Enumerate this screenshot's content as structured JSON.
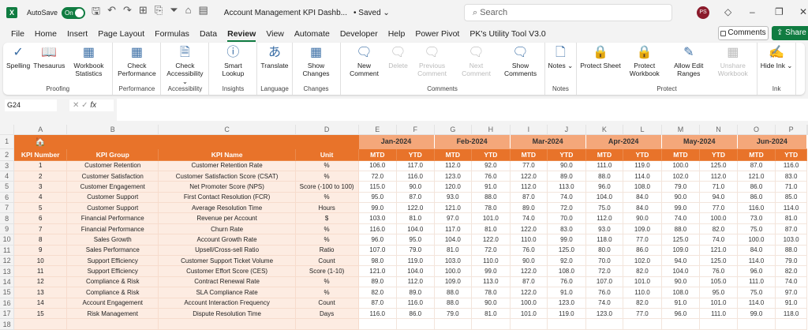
{
  "titlebar": {
    "app_icon": "X",
    "autosave_label": "AutoSave",
    "autosave_state": "On",
    "doc_title": "Account Management KPI Dashb...",
    "saved": "• Saved ⌄",
    "search_placeholder": "Search",
    "avatar": "PS"
  },
  "tabs": [
    "File",
    "Home",
    "Insert",
    "Page Layout",
    "Formulas",
    "Data",
    "Review",
    "View",
    "Automate",
    "Developer",
    "Help",
    "Power Pivot",
    "PK's Utility Tool V3.0"
  ],
  "active_tab": "Review",
  "comments_button": "Comments",
  "share_button": "Share",
  "ribbon": [
    {
      "group": "Proofing",
      "buttons": [
        {
          "label": "Spelling",
          "icon": "spelling-icon",
          "glyph": "✓"
        },
        {
          "label": "Thesaurus",
          "icon": "thesaurus-icon",
          "glyph": "📖"
        },
        {
          "label": "Workbook Statistics",
          "icon": "workbook-statistics-icon",
          "glyph": "▦"
        }
      ]
    },
    {
      "group": "Performance",
      "buttons": [
        {
          "label": "Check Performance",
          "icon": "check-performance-icon",
          "glyph": "▦"
        }
      ]
    },
    {
      "group": "Accessibility",
      "buttons": [
        {
          "label": "Check Accessibility ⌄",
          "icon": "check-accessibility-icon",
          "glyph": "🗎"
        }
      ]
    },
    {
      "group": "Insights",
      "buttons": [
        {
          "label": "Smart Lookup",
          "icon": "smart-lookup-icon",
          "glyph": "ⓘ"
        }
      ]
    },
    {
      "group": "Language",
      "buttons": [
        {
          "label": "Translate",
          "icon": "translate-icon",
          "glyph": "あ"
        }
      ]
    },
    {
      "group": "Changes",
      "buttons": [
        {
          "label": "Show Changes",
          "icon": "show-changes-icon",
          "glyph": "▦"
        }
      ]
    },
    {
      "group": "Comments",
      "buttons": [
        {
          "label": "New Comment",
          "icon": "new-comment-icon",
          "glyph": "🗨"
        },
        {
          "label": "Delete",
          "icon": "delete-comment-icon",
          "glyph": "🗨",
          "disabled": true
        },
        {
          "label": "Previous Comment",
          "icon": "previous-comment-icon",
          "glyph": "🗨",
          "disabled": true
        },
        {
          "label": "Next Comment",
          "icon": "next-comment-icon",
          "glyph": "🗨",
          "disabled": true
        },
        {
          "label": "Show Comments",
          "icon": "show-comments-icon",
          "glyph": "🗨"
        }
      ]
    },
    {
      "group": "Notes",
      "buttons": [
        {
          "label": "Notes ⌄",
          "icon": "notes-icon",
          "glyph": "🗋"
        }
      ]
    },
    {
      "group": "Protect",
      "buttons": [
        {
          "label": "Protect Sheet",
          "icon": "protect-sheet-icon",
          "glyph": "🔒"
        },
        {
          "label": "Protect Workbook",
          "icon": "protect-workbook-icon",
          "glyph": "🔒"
        },
        {
          "label": "Allow Edit Ranges",
          "icon": "allow-edit-ranges-icon",
          "glyph": "✎"
        },
        {
          "label": "Unshare Workbook",
          "icon": "unshare-workbook-icon",
          "glyph": "▦",
          "disabled": true
        }
      ]
    },
    {
      "group": "Ink",
      "buttons": [
        {
          "label": "Hide Ink ⌄",
          "icon": "hide-ink-icon",
          "glyph": "✍"
        }
      ]
    }
  ],
  "formula_bar": {
    "name_box": "G24",
    "fx": "fx",
    "value": ""
  },
  "sheet": {
    "columns": [
      "A",
      "B",
      "C",
      "D",
      "E",
      "F",
      "G",
      "H",
      "I",
      "J",
      "K",
      "L",
      "M",
      "N",
      "O",
      "P"
    ],
    "selected_column": "G",
    "headers": [
      "KPI Number",
      "KPI Group",
      "KPI Name",
      "Unit"
    ],
    "months": [
      "Jan-2024",
      "Feb-2024",
      "Mar-2024",
      "Apr-2024",
      "May-2024",
      "Jun-2024"
    ],
    "sub_headers": [
      "MTD",
      "YTD"
    ],
    "rows": [
      {
        "num": "1",
        "group": "Customer Retention",
        "name": "Customer Retention Rate",
        "unit": "%",
        "values": [
          "106.0",
          "117.0",
          "112.0",
          "92.0",
          "77.0",
          "90.0",
          "111.0",
          "119.0",
          "100.0",
          "125.0",
          "87.0",
          "116.0"
        ]
      },
      {
        "num": "2",
        "group": "Customer Satisfaction",
        "name": "Customer Satisfaction Score (CSAT)",
        "unit": "%",
        "values": [
          "72.0",
          "116.0",
          "123.0",
          "76.0",
          "122.0",
          "89.0",
          "88.0",
          "114.0",
          "102.0",
          "112.0",
          "121.0",
          "83.0"
        ]
      },
      {
        "num": "3",
        "group": "Customer Engagement",
        "name": "Net Promoter Score (NPS)",
        "unit": "Score (-100 to 100)",
        "values": [
          "115.0",
          "90.0",
          "120.0",
          "91.0",
          "112.0",
          "113.0",
          "96.0",
          "108.0",
          "79.0",
          "71.0",
          "86.0",
          "71.0"
        ]
      },
      {
        "num": "4",
        "group": "Customer Support",
        "name": "First Contact Resolution (FCR)",
        "unit": "%",
        "values": [
          "95.0",
          "87.0",
          "93.0",
          "88.0",
          "87.0",
          "74.0",
          "104.0",
          "84.0",
          "90.0",
          "94.0",
          "86.0",
          "85.0"
        ]
      },
      {
        "num": "5",
        "group": "Customer Support",
        "name": "Average Resolution Time",
        "unit": "Hours",
        "values": [
          "99.0",
          "122.0",
          "121.0",
          "78.0",
          "89.0",
          "72.0",
          "75.0",
          "84.0",
          "99.0",
          "77.0",
          "116.0",
          "114.0"
        ]
      },
      {
        "num": "6",
        "group": "Financial Performance",
        "name": "Revenue per Account",
        "unit": "$",
        "values": [
          "103.0",
          "81.0",
          "97.0",
          "101.0",
          "74.0",
          "70.0",
          "112.0",
          "90.0",
          "74.0",
          "100.0",
          "73.0",
          "81.0"
        ]
      },
      {
        "num": "7",
        "group": "Financial Performance",
        "name": "Churn Rate",
        "unit": "%",
        "values": [
          "116.0",
          "104.0",
          "117.0",
          "81.0",
          "122.0",
          "83.0",
          "93.0",
          "109.0",
          "88.0",
          "82.0",
          "75.0",
          "87.0"
        ]
      },
      {
        "num": "8",
        "group": "Sales Growth",
        "name": "Account Growth Rate",
        "unit": "%",
        "values": [
          "96.0",
          "95.0",
          "104.0",
          "122.0",
          "110.0",
          "99.0",
          "118.0",
          "77.0",
          "125.0",
          "74.0",
          "100.0",
          "103.0"
        ]
      },
      {
        "num": "9",
        "group": "Sales Performance",
        "name": "Upsell/Cross-sell Ratio",
        "unit": "Ratio",
        "values": [
          "107.0",
          "79.0",
          "81.0",
          "72.0",
          "76.0",
          "125.0",
          "80.0",
          "86.0",
          "109.0",
          "121.0",
          "84.0",
          "88.0"
        ]
      },
      {
        "num": "10",
        "group": "Support Efficiency",
        "name": "Customer Support Ticket Volume",
        "unit": "Count",
        "values": [
          "98.0",
          "119.0",
          "103.0",
          "110.0",
          "90.0",
          "92.0",
          "70.0",
          "102.0",
          "94.0",
          "125.0",
          "114.0",
          "79.0"
        ]
      },
      {
        "num": "11",
        "group": "Support Efficiency",
        "name": "Customer Effort Score (CES)",
        "unit": "Score (1-10)",
        "values": [
          "121.0",
          "104.0",
          "100.0",
          "99.0",
          "122.0",
          "108.0",
          "72.0",
          "82.0",
          "104.0",
          "76.0",
          "96.0",
          "82.0"
        ]
      },
      {
        "num": "12",
        "group": "Compliance & Risk",
        "name": "Contract Renewal Rate",
        "unit": "%",
        "values": [
          "89.0",
          "112.0",
          "109.0",
          "113.0",
          "87.0",
          "76.0",
          "107.0",
          "101.0",
          "90.0",
          "105.0",
          "111.0",
          "74.0"
        ]
      },
      {
        "num": "13",
        "group": "Compliance & Risk",
        "name": "SLA Compliance Rate",
        "unit": "%",
        "values": [
          "82.0",
          "89.0",
          "88.0",
          "78.0",
          "122.0",
          "91.0",
          "76.0",
          "110.0",
          "108.0",
          "95.0",
          "75.0",
          "97.0"
        ]
      },
      {
        "num": "14",
        "group": "Account Engagement",
        "name": "Account Interaction Frequency",
        "unit": "Count",
        "values": [
          "87.0",
          "116.0",
          "88.0",
          "90.0",
          "100.0",
          "123.0",
          "74.0",
          "82.0",
          "91.0",
          "101.0",
          "114.0",
          "91.0"
        ]
      },
      {
        "num": "15",
        "group": "Risk Management",
        "name": "Dispute Resolution Time",
        "unit": "Days",
        "values": [
          "116.0",
          "86.0",
          "79.0",
          "81.0",
          "101.0",
          "119.0",
          "123.0",
          "77.0",
          "96.0",
          "111.0",
          "99.0",
          "118.0"
        ]
      }
    ]
  }
}
